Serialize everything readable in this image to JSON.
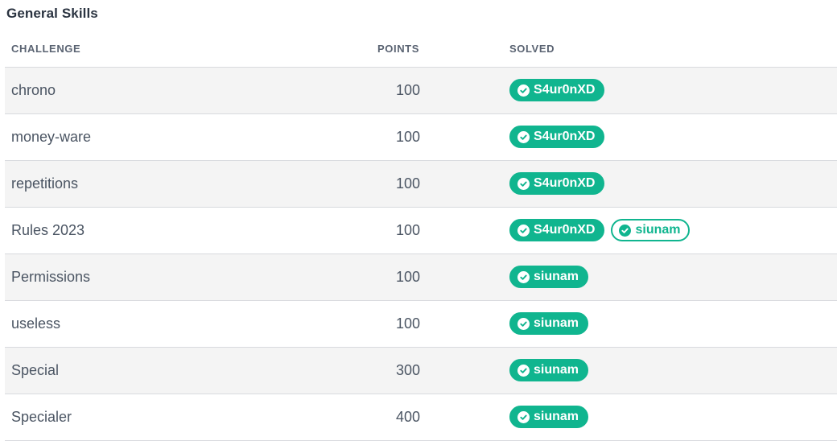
{
  "section": {
    "title": "General Skills"
  },
  "columns": {
    "challenge": "CHALLENGE",
    "points": "POINTS",
    "solved": "SOLVED"
  },
  "colors": {
    "accent": "#10b58f",
    "row_alt": "#f4f4f4",
    "text": "#4b5563"
  },
  "rows": [
    {
      "name": "chrono",
      "points": "100",
      "solvers": [
        {
          "user": "S4ur0nXD",
          "style": "filled"
        }
      ]
    },
    {
      "name": "money-ware",
      "points": "100",
      "solvers": [
        {
          "user": "S4ur0nXD",
          "style": "filled"
        }
      ]
    },
    {
      "name": "repetitions",
      "points": "100",
      "solvers": [
        {
          "user": "S4ur0nXD",
          "style": "filled"
        }
      ]
    },
    {
      "name": "Rules 2023",
      "points": "100",
      "solvers": [
        {
          "user": "S4ur0nXD",
          "style": "filled"
        },
        {
          "user": "siunam",
          "style": "outline"
        }
      ]
    },
    {
      "name": "Permissions",
      "points": "100",
      "solvers": [
        {
          "user": "siunam",
          "style": "filled"
        }
      ]
    },
    {
      "name": "useless",
      "points": "100",
      "solvers": [
        {
          "user": "siunam",
          "style": "filled"
        }
      ]
    },
    {
      "name": "Special",
      "points": "300",
      "solvers": [
        {
          "user": "siunam",
          "style": "filled"
        }
      ]
    },
    {
      "name": "Specialer",
      "points": "400",
      "solvers": [
        {
          "user": "siunam",
          "style": "filled"
        }
      ]
    }
  ]
}
